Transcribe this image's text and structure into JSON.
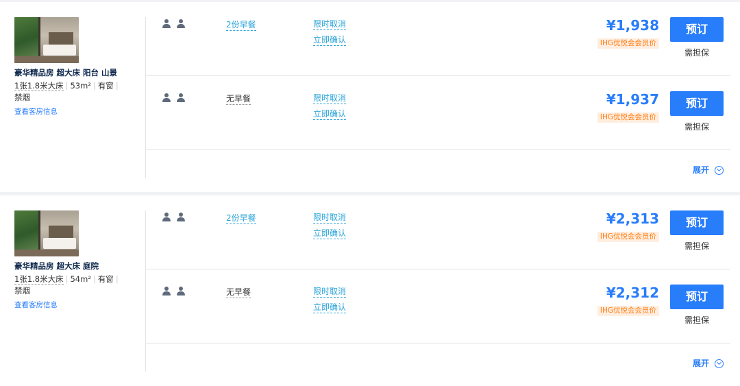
{
  "rooms": [
    {
      "name": "豪华精品房 超大床 阳台 山景",
      "bed": "1张1.8米大床",
      "area": "53m²",
      "window": "有窗",
      "smoking": "禁烟",
      "link": "查看客房信息",
      "expand_label": "展开",
      "rates": [
        {
          "meal": "2份早餐",
          "cancel": "限时取消",
          "confirm": "立即确认",
          "price": "¥1,938",
          "member_tag": "IHG优悦会会员价",
          "book_label": "预订",
          "guarantee": "需担保"
        },
        {
          "meal": "无早餐",
          "cancel": "限时取消",
          "confirm": "立即确认",
          "price": "¥1,937",
          "member_tag": "IHG优悦会会员价",
          "book_label": "预订",
          "guarantee": "需担保"
        }
      ]
    },
    {
      "name": "豪华精品房 超大床 庭院",
      "bed": "1张1.8米大床",
      "area": "54m²",
      "window": "有窗",
      "smoking": "禁烟",
      "link": "查看客房信息",
      "expand_label": "展开",
      "rates": [
        {
          "meal": "2份早餐",
          "cancel": "限时取消",
          "confirm": "立即确认",
          "price": "¥2,313",
          "member_tag": "IHG优悦会会员价",
          "book_label": "预订",
          "guarantee": "需担保"
        },
        {
          "meal": "无早餐",
          "cancel": "限时取消",
          "confirm": "立即确认",
          "price": "¥2,312",
          "member_tag": "IHG优悦会会员价",
          "book_label": "预订",
          "guarantee": "需担保"
        }
      ]
    }
  ],
  "icons": {
    "guests": "person-icon",
    "expand": "chevron-down-circle-icon"
  },
  "colors": {
    "accent": "#287dfa",
    "meal_link": "#2ba4d9",
    "member_tag_text": "#ff7d13",
    "member_tag_bg": "#ffeee0"
  }
}
